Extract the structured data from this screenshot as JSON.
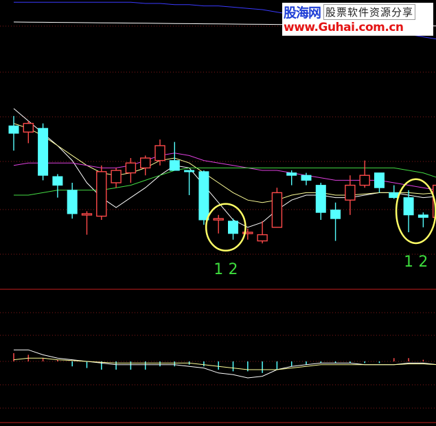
{
  "watermark": {
    "brand": "股海网",
    "tagline": "股票软件资源分享",
    "url": "www.Guhai.com.cn"
  },
  "annotations": [
    {
      "label": "1",
      "color": "#3ddc3d"
    },
    {
      "label": "2",
      "color": "#3ddc3d"
    },
    {
      "label": "1",
      "color": "#3ddc3d"
    },
    {
      "label": "2",
      "color": "#3ddc3d"
    }
  ],
  "colors": {
    "up": "#ff4a4a",
    "down": "#55ffff",
    "highlight_ellipse": "#ffff66",
    "ma_white": "#ffffff",
    "ma_yellow": "#ffff99",
    "ma_magenta": "#e040e0",
    "ma_green": "#44dd44",
    "ma_blue": "#3a3aff",
    "grid": "#8a1a1a"
  },
  "chart_data": {
    "type": "candlestick",
    "title": "",
    "xlabel": "",
    "ylabel": "",
    "ylim": [
      0,
      100
    ],
    "grid": true,
    "candles": [
      {
        "open": 76,
        "high": 84,
        "low": 56,
        "close": 70
      },
      {
        "open": 71,
        "high": 80,
        "low": 62,
        "close": 78
      },
      {
        "open": 74,
        "high": 78,
        "low": 32,
        "close": 36
      },
      {
        "open": 35,
        "high": 37,
        "low": 18,
        "close": 28
      },
      {
        "open": 24,
        "high": 30,
        "low": 1,
        "close": 5
      },
      {
        "open": 5,
        "high": 7,
        "low": -12,
        "close": 5
      },
      {
        "open": 3,
        "high": 44,
        "low": 0,
        "close": 39
      },
      {
        "open": 30,
        "high": 42,
        "low": 26,
        "close": 40
      },
      {
        "open": 38,
        "high": 50,
        "low": 30,
        "close": 46
      },
      {
        "open": 42,
        "high": 52,
        "low": 36,
        "close": 50
      },
      {
        "open": 48,
        "high": 65,
        "low": 44,
        "close": 60
      },
      {
        "open": 48,
        "high": 63,
        "low": 48,
        "close": 40
      },
      {
        "open": 40,
        "high": 40,
        "low": 20,
        "close": 39
      },
      {
        "open": 39,
        "high": 40,
        "low": -4,
        "close": 0
      },
      {
        "open": 0,
        "high": 4,
        "low": -11,
        "close": 1
      },
      {
        "open": -1,
        "high": 1,
        "low": -16,
        "close": -11
      },
      {
        "open": -10,
        "high": -7,
        "low": -16,
        "close": -10
      },
      {
        "open": -17,
        "high": -1,
        "low": -19,
        "close": -12
      },
      {
        "open": -6,
        "high": 26,
        "low": -6,
        "close": 22
      },
      {
        "open": 38,
        "high": 40,
        "low": 28,
        "close": 36
      },
      {
        "open": 36,
        "high": 38,
        "low": 28,
        "close": 32
      },
      {
        "open": 28,
        "high": 30,
        "low": 0,
        "close": 6
      },
      {
        "open": 8,
        "high": 14,
        "low": -17,
        "close": 1
      },
      {
        "open": 16,
        "high": 36,
        "low": 4,
        "close": 28
      },
      {
        "open": 28,
        "high": 48,
        "low": 26,
        "close": 36
      },
      {
        "open": 38,
        "high": 38,
        "low": 22,
        "close": 26
      },
      {
        "open": 22,
        "high": 28,
        "low": 17,
        "close": 18
      },
      {
        "open": 18,
        "high": 24,
        "low": -10,
        "close": 4
      },
      {
        "open": 4,
        "high": 6,
        "low": -6,
        "close": 2
      },
      {
        "open": 2,
        "high": 44,
        "low": -6,
        "close": 28
      }
    ],
    "ma_lines": [
      {
        "color_key": "ma_white",
        "values": [
          90,
          80,
          70,
          60,
          48,
          30,
          18,
          10,
          18,
          26,
          36,
          44,
          42,
          28,
          14,
          0,
          -6,
          -2,
          8,
          16,
          20,
          20,
          18,
          18,
          20,
          22,
          22,
          20,
          18,
          19
        ]
      },
      {
        "color_key": "ma_yellow",
        "values": [
          78,
          74,
          68,
          60,
          52,
          44,
          38,
          36,
          38,
          42,
          48,
          50,
          46,
          38,
          30,
          22,
          16,
          14,
          16,
          20,
          22,
          22,
          20,
          20,
          21,
          22,
          22,
          22,
          21,
          22
        ]
      },
      {
        "color_key": "ma_magenta",
        "values": [
          44,
          46,
          46,
          46,
          46,
          44,
          42,
          42,
          44,
          48,
          52,
          54,
          52,
          48,
          46,
          44,
          42,
          40,
          40,
          38,
          36,
          34,
          32,
          32,
          32,
          32,
          30,
          28,
          26,
          24
        ]
      },
      {
        "color_key": "ma_green",
        "values": [
          20,
          20,
          22,
          24,
          24,
          24,
          24,
          26,
          28,
          32,
          36,
          40,
          42,
          42,
          42,
          42,
          42,
          42,
          42,
          42,
          42,
          42,
          42,
          42,
          42,
          42,
          42,
          40,
          38,
          34
        ]
      },
      {
        "color_key": "ma_blue",
        "values": [
          176,
          176,
          176,
          176,
          176,
          176,
          176,
          176,
          176,
          175,
          175,
          174,
          174,
          173,
          173,
          172,
          171,
          170,
          168,
          166,
          164,
          162,
          160,
          158,
          156,
          154,
          152,
          150,
          148,
          146
        ]
      }
    ],
    "ma_white_flat": {
      "color_key": "ma_white",
      "values": [
        200,
        200,
        200,
        200,
        200,
        200,
        200,
        200,
        200,
        200,
        200,
        200,
        200,
        200,
        200,
        200,
        200,
        200,
        200,
        200,
        200,
        200,
        200,
        200,
        200,
        200,
        200,
        200,
        200,
        200
      ]
    },
    "highlighted_candles": [
      [
        14,
        15
      ],
      [
        27,
        28
      ]
    ],
    "indicator": {
      "ylim": [
        -40,
        40
      ],
      "histogram": [
        10,
        8,
        4,
        2,
        -6,
        -8,
        -10,
        -10,
        -10,
        -10,
        -6,
        -6,
        -4,
        -6,
        -10,
        -12,
        -12,
        -14,
        -10,
        -6,
        -4,
        -2,
        -2,
        -2,
        -2,
        -2,
        4,
        4,
        2,
        2
      ],
      "line_white": [
        14,
        14,
        8,
        4,
        2,
        0,
        -2,
        -4,
        -4,
        -4,
        -4,
        -4,
        -6,
        -8,
        -14,
        -16,
        -20,
        -18,
        -10,
        -6,
        -4,
        -2,
        -2,
        -2,
        -4,
        -4,
        -4,
        -2,
        -2,
        -4
      ],
      "line_yellow": [
        2,
        4,
        4,
        2,
        1,
        0,
        -1,
        -2,
        -2,
        -2,
        -2,
        -2,
        -2,
        -4,
        -6,
        -8,
        -10,
        -10,
        -10,
        -8,
        -6,
        -4,
        -4,
        -4,
        -4,
        -4,
        -4,
        -3,
        -3,
        -4
      ]
    }
  }
}
